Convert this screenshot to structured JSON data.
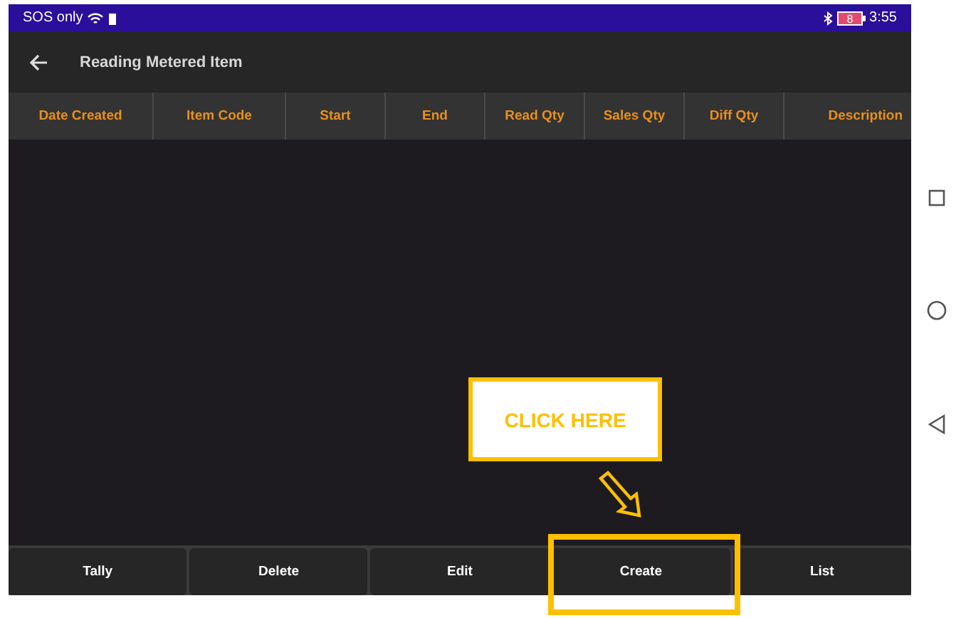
{
  "status_bar": {
    "carrier": "SOS only",
    "battery": "8",
    "time": "3:55"
  },
  "toolbar": {
    "title": "Reading Metered Item"
  },
  "table": {
    "columns": [
      "Date Created",
      "Item Code",
      "Start",
      "End",
      "Read Qty",
      "Sales Qty",
      "Diff Qty",
      "Description"
    ]
  },
  "buttons": [
    {
      "label": "Tally",
      "highlighted": false
    },
    {
      "label": "Delete",
      "highlighted": false
    },
    {
      "label": "Edit",
      "highlighted": false
    },
    {
      "label": "Create",
      "highlighted": true
    },
    {
      "label": "List",
      "highlighted": false
    }
  ],
  "callout": {
    "text": "CLICK HERE"
  }
}
